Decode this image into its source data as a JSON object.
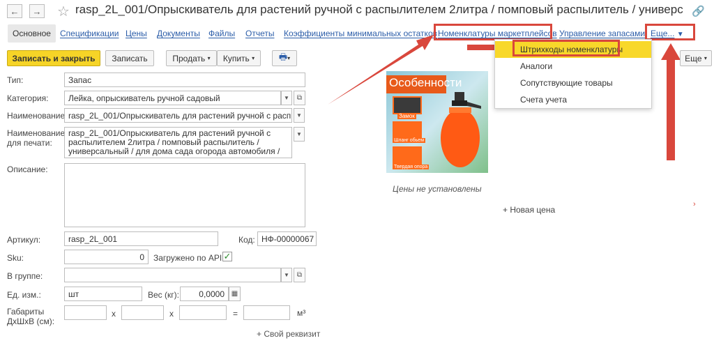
{
  "window": {
    "title": "rasp_2L_001/Опрыскиватель для растений ручной с распылителем 2литра / помповый распылитель / универс (Номенк...",
    "back_icon": "arrow-left-icon",
    "forward_icon": "arrow-right-icon"
  },
  "tabs": [
    {
      "label": "Основное",
      "active": true
    },
    {
      "label": "Спецификации"
    },
    {
      "label": "Цены"
    },
    {
      "label": "Документы"
    },
    {
      "label": "Файлы"
    },
    {
      "label": "Отчеты"
    },
    {
      "label": "Коэффициенты минимальных остатков"
    },
    {
      "label": "Номенклатуры маркетплейсов"
    },
    {
      "label": "Управление запасами"
    },
    {
      "label": "Еще..."
    }
  ],
  "more_menu": {
    "items": [
      "Штрихкоды номенклатуры",
      "Аналоги",
      "Сопутствующие товары",
      "Счета учета"
    ],
    "highlighted": 0
  },
  "toolbar": {
    "save_close": "Записать и закрыть",
    "save": "Записать",
    "sell": "Продать",
    "buy": "Купить",
    "more": "Еще"
  },
  "form": {
    "type_label": "Тип:",
    "type_value": "Запас",
    "category_label": "Категория:",
    "category_value": "Лейка, опрыскиватель ручной садовый",
    "name_label": "Наименование:",
    "name_value": "rasp_2L_001/Опрыскиватель для растений ручной с распылит",
    "print_name_label": "Наименование для печати:",
    "print_name_value": "rasp_2L_001/Опрыскиватель для растений ручной с распылителем 2литра / помповый распылитель / универсальный / для дома сада огорода автомобиля / для",
    "description_label": "Описание:",
    "article_label": "Артикул:",
    "article_value": "rasp_2L_001",
    "code_label": "Код:",
    "code_value": "НФ-00000067",
    "sku_label": "Sku:",
    "sku_value": "0",
    "api_label": "Загружено по API:",
    "api_checked": true,
    "group_label": "В группе:",
    "group_value": "",
    "unit_label": "Ед. изм.:",
    "unit_value": "шт",
    "weight_label": "Вес (кг):",
    "weight_value": "0,0000",
    "dims_label": "Габариты ДхШхВ (см):",
    "dims_x1": "x",
    "dims_x2": "x",
    "dims_eq": "=",
    "dims_unit": "м³",
    "custom_attr": "+ Свой реквизит"
  },
  "side": {
    "image_caption": "Особенности",
    "image_tags": [
      "Замок",
      "Шланг обьем",
      "Твердая опора"
    ],
    "no_prices": "Цены не установлены",
    "new_price": "+ Новая цена"
  },
  "colors": {
    "primary_button": "#f6d427",
    "link": "#2a5ca8",
    "callout": "#d9473c",
    "menu_highlight": "#f8d82a"
  }
}
